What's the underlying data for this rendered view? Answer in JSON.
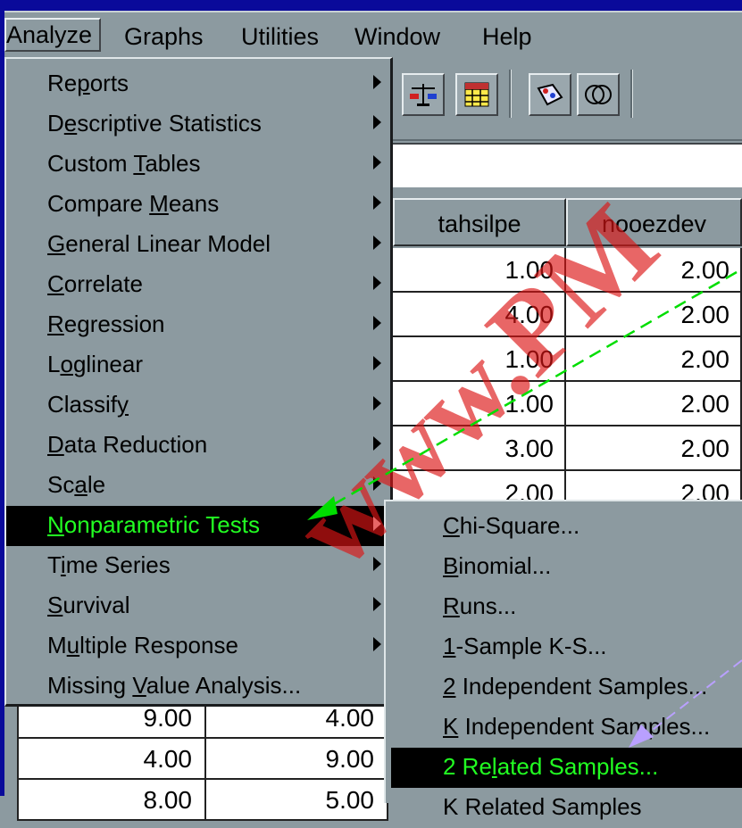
{
  "menubar": {
    "items": [
      {
        "label": "Analyze",
        "active": true
      },
      {
        "label": "Graphs"
      },
      {
        "label": "Utilities"
      },
      {
        "label": "Window"
      },
      {
        "label": "Help"
      }
    ]
  },
  "toolbar": {
    "icons": [
      "balance-scale-icon",
      "grid-table-icon",
      "value-labels-icon",
      "use-sets-icon"
    ]
  },
  "grid": {
    "columns": [
      "tahsilpe",
      "nooezdev"
    ],
    "rows": [
      [
        "1.00",
        "2.00"
      ],
      [
        "4.00",
        "2.00"
      ],
      [
        "1.00",
        "2.00"
      ],
      [
        "1.00",
        "2.00"
      ],
      [
        "3.00",
        "2.00"
      ],
      [
        "2.00",
        "2.00"
      ]
    ],
    "left_rows": [
      [
        "9.00",
        "4.00"
      ],
      [
        "4.00",
        "9.00"
      ],
      [
        "8.00",
        "5.00"
      ]
    ]
  },
  "analyze_menu": {
    "items": [
      {
        "pre": "Re",
        "key": "p",
        "post": "orts",
        "submenu": true
      },
      {
        "pre": "D",
        "key": "e",
        "post": "scriptive Statistics",
        "submenu": true
      },
      {
        "pre": "Custom ",
        "key": "T",
        "post": "ables",
        "submenu": true
      },
      {
        "pre": "Compare ",
        "key": "M",
        "post": "eans",
        "submenu": true
      },
      {
        "pre": "",
        "key": "G",
        "post": "eneral Linear Model",
        "submenu": true
      },
      {
        "pre": "",
        "key": "C",
        "post": "orrelate",
        "submenu": true
      },
      {
        "pre": "",
        "key": "R",
        "post": "egression",
        "submenu": true
      },
      {
        "pre": "L",
        "key": "o",
        "post": "glinear",
        "submenu": true
      },
      {
        "pre": "Classif",
        "key": "y",
        "post": "",
        "submenu": true
      },
      {
        "pre": "",
        "key": "D",
        "post": "ata Reduction",
        "submenu": true
      },
      {
        "pre": "Sc",
        "key": "a",
        "post": "le",
        "submenu": true
      },
      {
        "pre": "",
        "key": "N",
        "post": "onparametric Tests",
        "submenu": true,
        "selected": true
      },
      {
        "pre": "T",
        "key": "i",
        "post": "me Series",
        "submenu": true
      },
      {
        "pre": "",
        "key": "S",
        "post": "urvival",
        "submenu": true
      },
      {
        "pre": "M",
        "key": "u",
        "post": "ltiple Response",
        "submenu": true
      },
      {
        "pre": "Missing ",
        "key": "V",
        "post": "alue Analysis...",
        "submenu": false
      }
    ]
  },
  "nonparametric_submenu": {
    "items": [
      {
        "pre": "",
        "key": "C",
        "post": "hi-Square..."
      },
      {
        "pre": "",
        "key": "B",
        "post": "inomial..."
      },
      {
        "pre": "",
        "key": "R",
        "post": "uns..."
      },
      {
        "pre": "",
        "key": "1",
        "post": "-Sample K-S..."
      },
      {
        "pre": "",
        "key": "2",
        "post": " Independent Samples..."
      },
      {
        "pre": "",
        "key": "K",
        "post": " Independent Samples..."
      },
      {
        "pre": "2 Re",
        "key": "l",
        "post": "ated Samples...",
        "selected": true
      },
      {
        "pre": "K Related Samples",
        "key": "",
        "post": ""
      }
    ]
  },
  "watermark": {
    "text": "www.PM"
  },
  "colors": {
    "highlight_text": "#22ff22",
    "arrow_green": "#00dd00",
    "arrow_violet": "#b9a0ff",
    "title_blue": "#0a0a9a"
  }
}
